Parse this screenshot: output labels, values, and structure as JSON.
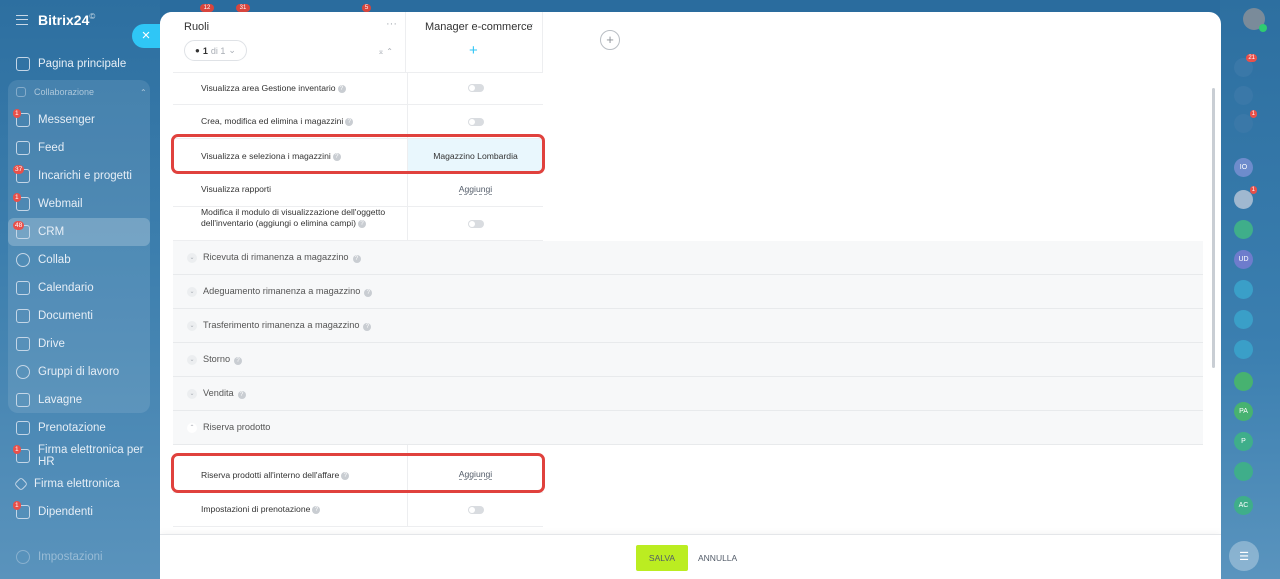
{
  "app": {
    "brand": "Bitrix24",
    "brand_mark": "©"
  },
  "sidebar": {
    "items": [
      {
        "label": "Pagina principale",
        "icon": "home-icon"
      },
      {
        "label": "Collaborazione",
        "icon": "collab-group-icon"
      },
      {
        "label": "Messenger",
        "icon": "messenger-icon",
        "badge": "1"
      },
      {
        "label": "Feed",
        "icon": "feed-icon"
      },
      {
        "label": "Incarichi e progetti",
        "icon": "tasks-icon",
        "badge": "37"
      },
      {
        "label": "Webmail",
        "icon": "mail-icon",
        "badge": "1"
      },
      {
        "label": "CRM",
        "icon": "crm-icon",
        "badge": "48"
      },
      {
        "label": "Collab",
        "icon": "collab-icon"
      },
      {
        "label": "Calendario",
        "icon": "calendar-icon"
      },
      {
        "label": "Documenti",
        "icon": "documents-icon"
      },
      {
        "label": "Drive",
        "icon": "drive-icon"
      },
      {
        "label": "Gruppi di lavoro",
        "icon": "groups-icon"
      },
      {
        "label": "Lavagne",
        "icon": "boards-icon"
      },
      {
        "label": "Prenotazione",
        "icon": "booking-icon"
      },
      {
        "label": "Firma elettronica per HR",
        "icon": "hr-sign-icon",
        "badge": "1"
      },
      {
        "label": "Firma elettronica",
        "icon": "sign-icon"
      },
      {
        "label": "Dipendenti",
        "icon": "employees-icon",
        "badge": "1"
      },
      {
        "label": "Impostazioni",
        "icon": "settings-icon"
      }
    ]
  },
  "topbar_badges": [
    "12",
    "31",
    "5"
  ],
  "rightbar": {
    "items": [
      {
        "icon": "notifications-icon",
        "badge": "21",
        "color": "#3a78a8",
        "text": ""
      },
      {
        "icon": "activity-icon",
        "badge": "",
        "color": "#3a78a8",
        "text": ""
      },
      {
        "icon": "chat-icon",
        "badge": "1",
        "color": "#3a78a8",
        "text": ""
      },
      {
        "icon": "user-avatar-icon",
        "badge": "",
        "color": "#6e8ccc",
        "text": "IO"
      },
      {
        "icon": "user-avatar-icon",
        "badge": "1",
        "color": "#a0b8d0",
        "text": ""
      },
      {
        "icon": "task-chat-icon",
        "badge": "",
        "color": "#3fae8a",
        "text": ""
      },
      {
        "icon": "user-avatar-icon",
        "badge": "",
        "color": "#6e7ccc",
        "text": "UD"
      },
      {
        "icon": "group-chat-icon",
        "badge": "",
        "color": "#3a9fc8",
        "text": ""
      },
      {
        "icon": "group-chat-icon",
        "badge": "",
        "color": "#3a9fc8",
        "text": ""
      },
      {
        "icon": "open-channel-icon",
        "badge": "",
        "color": "#3a9fc8",
        "text": ""
      },
      {
        "icon": "group-chat-icon",
        "badge": "",
        "color": "#47b270",
        "text": ""
      },
      {
        "icon": "user-avatar-icon",
        "badge": "",
        "color": "#47b270",
        "text": "PA"
      },
      {
        "icon": "user-avatar-icon",
        "badge": "",
        "color": "#3fae8a",
        "text": "P"
      },
      {
        "icon": "task-chat-icon",
        "badge": "",
        "color": "#3fae8a",
        "text": ""
      },
      {
        "icon": "user-avatar-icon",
        "badge": "",
        "color": "#3fae8a",
        "text": "AC"
      }
    ]
  },
  "grid": {
    "roles_header": "Ruoli",
    "roles_menu": "···",
    "pager": {
      "current": "1",
      "of": "di 1"
    },
    "role_column": {
      "title": "Manager e-commerce",
      "menu": "···",
      "add": "+"
    },
    "add_role": "+",
    "rows_top": [
      {
        "label": "Visualizza area Gestione inventario",
        "value_type": "toggle",
        "value": ""
      },
      {
        "label": "Crea, modifica ed elimina i magazzini",
        "value_type": "toggle",
        "value": ""
      },
      {
        "label": "Visualizza e seleziona i magazzini",
        "value_type": "text",
        "value": "Magazzino Lombardia",
        "highlight": true
      },
      {
        "label": "Visualizza rapporti",
        "value_type": "link",
        "value": "Aggiungi"
      },
      {
        "label": "Modifica il modulo di visualizzazione dell'oggetto dell'inventario (aggiungi o elimina campi)",
        "value_type": "toggle",
        "value": ""
      }
    ],
    "sections": [
      {
        "title": "Ricevuta di rimanenza a magazzino",
        "expanded": false
      },
      {
        "title": "Adeguamento rimanenza a magazzino",
        "expanded": false
      },
      {
        "title": "Trasferimento rimanenza a magazzino",
        "expanded": false
      },
      {
        "title": "Storno",
        "expanded": false
      },
      {
        "title": "Vendita",
        "expanded": false
      },
      {
        "title": "Riserva prodotto",
        "expanded": true
      }
    ],
    "rows_reserve": [
      {
        "label": "Riserva prodotti all'interno dell'affare",
        "value_type": "link",
        "value": "Aggiungi"
      },
      {
        "label": "Impostazioni di prenotazione",
        "value_type": "toggle",
        "value": ""
      }
    ]
  },
  "footer": {
    "save": "SALVA",
    "cancel": "ANNULLA"
  },
  "colors": {
    "accent": "#2fc6f6",
    "save": "#bbed21",
    "highlight_box": "#e0413d"
  }
}
